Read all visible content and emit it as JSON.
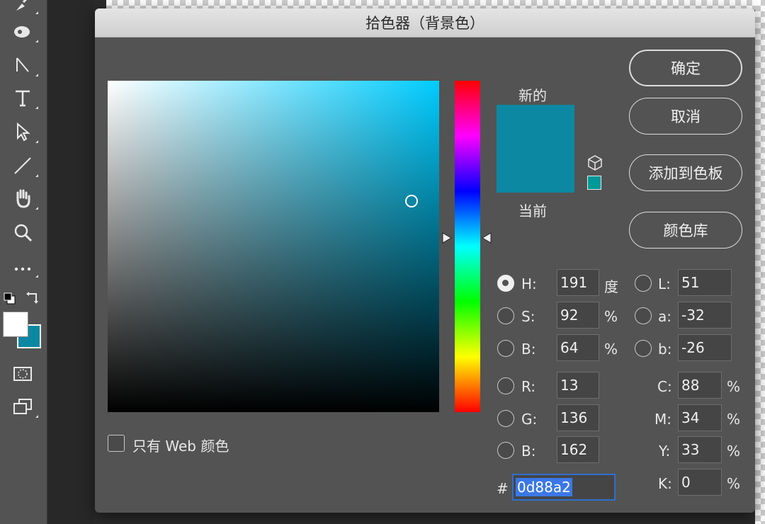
{
  "dialog": {
    "title": "拾色器（背景色）",
    "buttons": {
      "ok": "确定",
      "cancel": "取消",
      "add_to_swatches": "添加到色板",
      "color_libraries": "颜色库"
    },
    "swatch_labels": {
      "new": "新的",
      "current": "当前"
    },
    "web_only_label": "只有 Web 颜色",
    "web_only_checked": false,
    "hsb": {
      "h": {
        "label": "H:",
        "value": "191",
        "unit": "度",
        "selected": true
      },
      "s": {
        "label": "S:",
        "value": "92",
        "unit": "%"
      },
      "b": {
        "label": "B:",
        "value": "64",
        "unit": "%"
      }
    },
    "rgb": {
      "r": {
        "label": "R:",
        "value": "13"
      },
      "g": {
        "label": "G:",
        "value": "136"
      },
      "b": {
        "label": "B:",
        "value": "162"
      }
    },
    "lab": {
      "l": {
        "label": "L:",
        "value": "51"
      },
      "a": {
        "label": "a:",
        "value": "-32"
      },
      "b": {
        "label": "b:",
        "value": "-26"
      }
    },
    "cmyk": {
      "c": {
        "label": "C:",
        "value": "88",
        "unit": "%"
      },
      "m": {
        "label": "M:",
        "value": "34",
        "unit": "%"
      },
      "y": {
        "label": "Y:",
        "value": "33",
        "unit": "%"
      },
      "k": {
        "label": "K:",
        "value": "0",
        "unit": "%"
      }
    },
    "hex": {
      "label": "#",
      "value": "0d88a2"
    },
    "colors": {
      "new_color": "#0d88a2",
      "current_color": "#0d88a2",
      "hue_base": "#00ccff",
      "web_safe_swatch": "#009999"
    }
  },
  "toolbar": {
    "icons": [
      "brush-icon",
      "eraser-icon",
      "path-selection-icon",
      "text-icon",
      "direct-selection-icon",
      "line-icon",
      "hand-icon",
      "zoom-icon",
      "more-tools-icon",
      "default-colors-icon",
      "swap-colors-icon",
      "quick-mask-icon",
      "screen-mode-icon"
    ],
    "foreground_color": "#ffffff",
    "background_color": "#0d88a2"
  }
}
